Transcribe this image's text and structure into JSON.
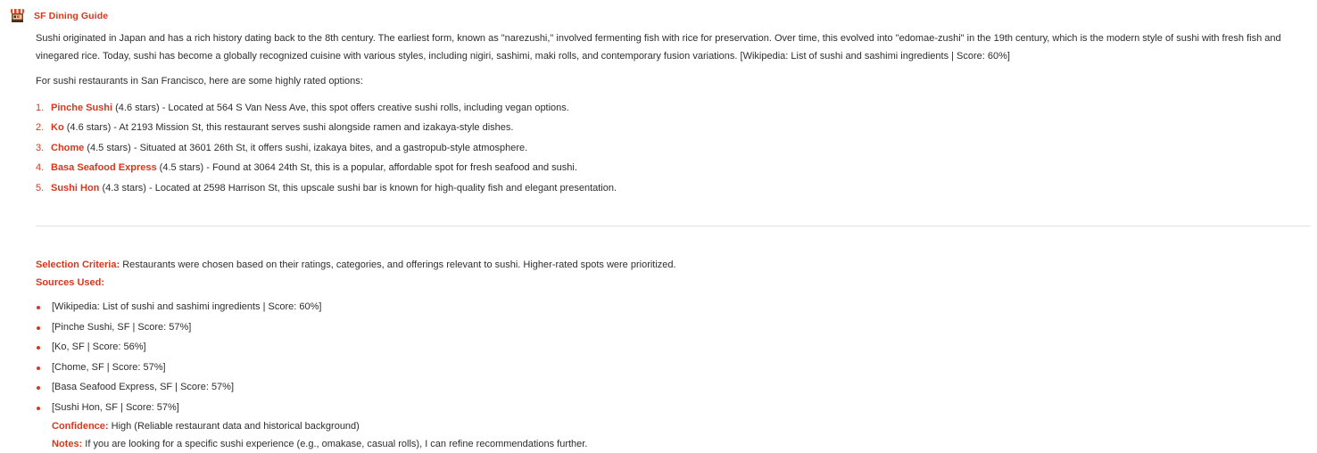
{
  "header": {
    "app_name": "SF Dining Guide",
    "avatar_icon": "restaurant-stand-icon"
  },
  "message": {
    "intro": "Sushi originated in Japan and has a rich history dating back to the 8th century. The earliest form, known as \"narezushi,\" involved fermenting fish with rice for preservation. Over time, this evolved into \"edomae-zushi\" in the 19th century, which is the modern style of sushi with fresh fish and vinegared rice. Today, sushi has become a globally recognized cuisine with various styles, including nigiri, sashimi, maki rolls, and contemporary fusion variations. [Wikipedia: List of sushi and sashimi ingredients | Score: 60%]",
    "lead": "For sushi restaurants in San Francisco, here are some highly rated options:",
    "restaurants": [
      {
        "num": "1.",
        "name": "Pinche Sushi",
        "detail": " (4.6 stars) - Located at 564 S Van Ness Ave, this spot offers creative sushi rolls, including vegan options."
      },
      {
        "num": "2.",
        "name": "Ko",
        "detail": " (4.6 stars) - At 2193 Mission St, this restaurant serves sushi alongside ramen and izakaya-style dishes."
      },
      {
        "num": "3.",
        "name": "Chome",
        "detail": " (4.5 stars) - Situated at 3601 26th St, it offers sushi, izakaya bites, and a gastropub-style atmosphere."
      },
      {
        "num": "4.",
        "name": "Basa Seafood Express",
        "detail": " (4.5 stars) - Found at 3064 24th St, this is a popular, affordable spot for fresh seafood and sushi."
      },
      {
        "num": "5.",
        "name": "Sushi Hon",
        "detail": " (4.3 stars) - Located at 2598 Harrison St, this upscale sushi bar is known for high-quality fish and elegant presentation."
      }
    ],
    "criteria_label": "Selection Criteria:",
    "criteria_text": " Restaurants were chosen based on their ratings, categories, and offerings relevant to sushi. Higher-rated spots were prioritized.",
    "sources_label": "Sources Used:",
    "sources": [
      "[Wikipedia: List of sushi and sashimi ingredients | Score: 60%]",
      "[Pinche Sushi, SF | Score: 57%]",
      "[Ko, SF | Score: 56%]",
      "[Chome, SF | Score: 57%]",
      "[Basa Seafood Express, SF | Score: 57%]",
      "[Sushi Hon, SF | Score: 57%]"
    ],
    "confidence_label": "Confidence:",
    "confidence_text": " High (Reliable restaurant data and historical background)",
    "notes_label": "Notes:",
    "notes_text": " If you are looking for a specific sushi experience (e.g., omakase, casual rolls), I can refine recommendations further."
  },
  "colors": {
    "accent": "#d9361c",
    "text": "#2d2d2d",
    "divider": "#e3e3e3"
  }
}
